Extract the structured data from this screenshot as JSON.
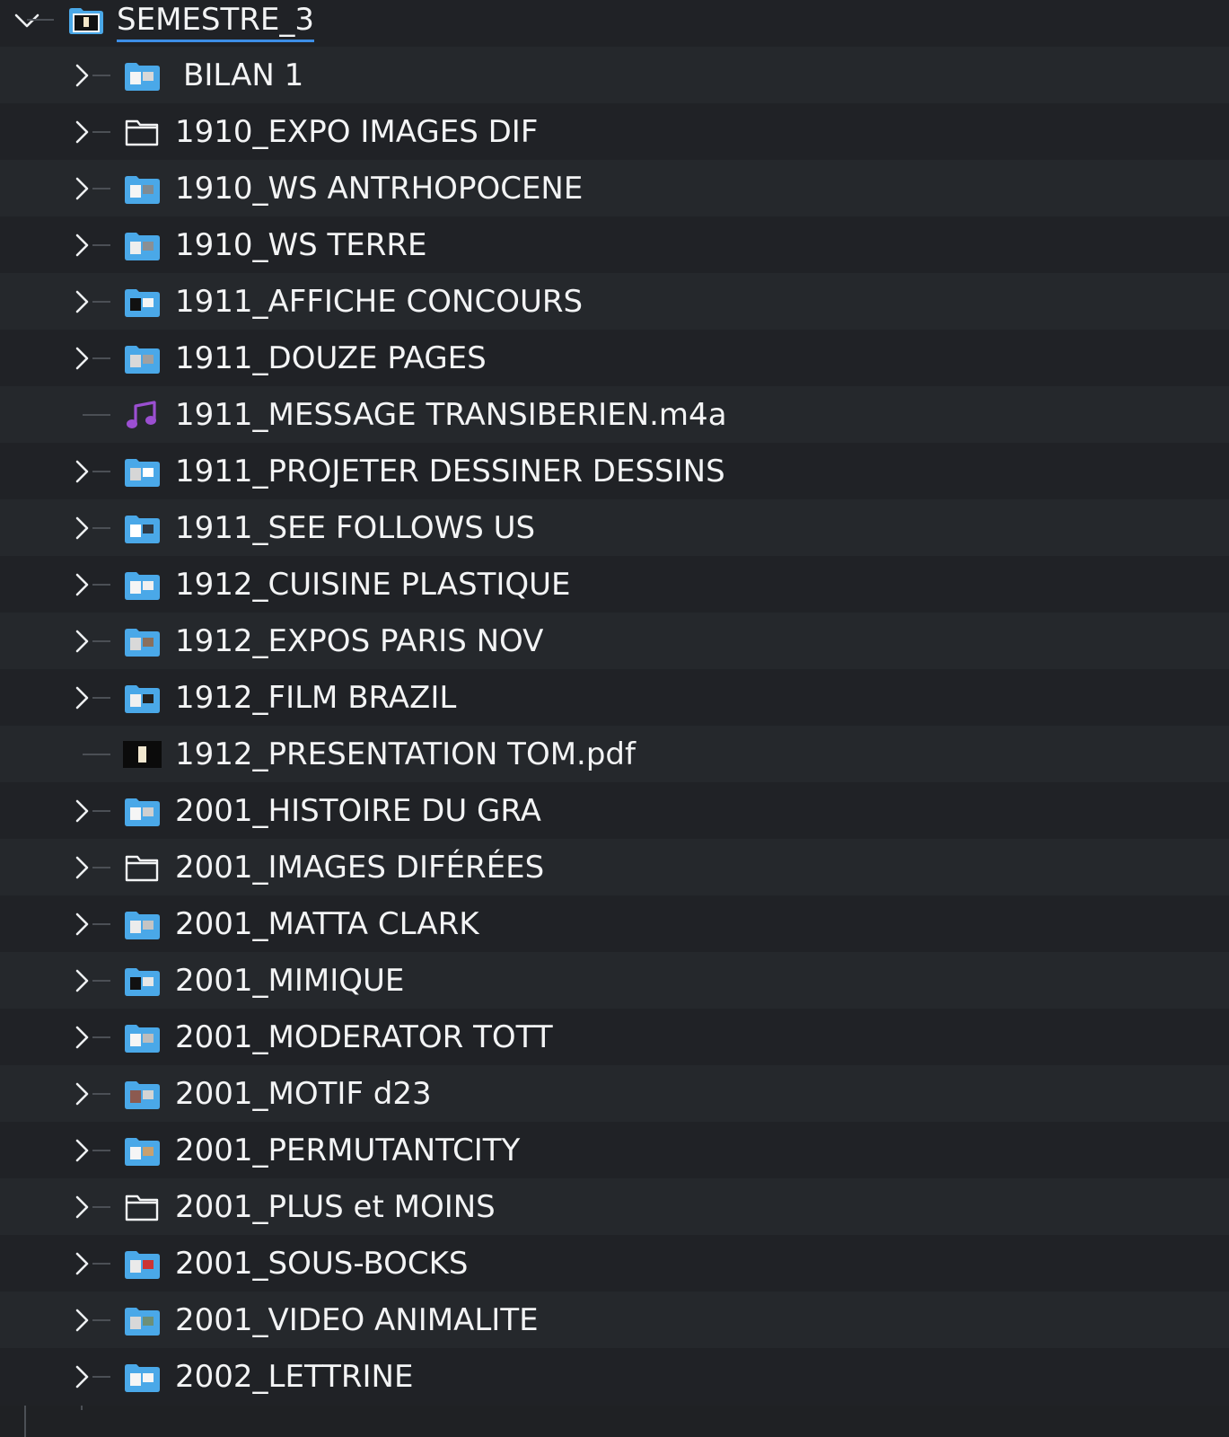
{
  "root": {
    "label": "SEMESTRE_3",
    "expanded": true,
    "icon": "folder-dark-thumb-icon"
  },
  "items": [
    {
      "label": "BILAN 1",
      "kind": "folder-thumb",
      "expandable": true
    },
    {
      "label": "1910_EXPO IMAGES DIF",
      "kind": "folder-outline",
      "expandable": true
    },
    {
      "label": "1910_WS ANTRHOPOCENE",
      "kind": "folder-thumb",
      "expandable": true
    },
    {
      "label": "1910_WS TERRE",
      "kind": "folder-thumb",
      "expandable": true
    },
    {
      "label": "1911_AFFICHE CONCOURS",
      "kind": "folder-thumb",
      "expandable": true
    },
    {
      "label": "1911_DOUZE PAGES",
      "kind": "folder-thumb",
      "expandable": true
    },
    {
      "label": "1911_MESSAGE TRANSIBERIEN.m4a",
      "kind": "audio",
      "expandable": false
    },
    {
      "label": "1911_PROJETER DESSINER DESSINS",
      "kind": "folder-thumb",
      "expandable": true
    },
    {
      "label": "1911_SEE FOLLOWS US",
      "kind": "folder-thumb",
      "expandable": true
    },
    {
      "label": "1912_CUISINE PLASTIQUE",
      "kind": "folder-thumb",
      "expandable": true
    },
    {
      "label": "1912_EXPOS PARIS NOV",
      "kind": "folder-thumb",
      "expandable": true
    },
    {
      "label": "1912_FILM BRAZIL",
      "kind": "folder-thumb",
      "expandable": true
    },
    {
      "label": "1912_PRESENTATION TOM.pdf",
      "kind": "pdf",
      "expandable": false
    },
    {
      "label": "2001_HISTOIRE DU GRA",
      "kind": "folder-thumb",
      "expandable": true
    },
    {
      "label": "2001_IMAGES DIFÉRÉES",
      "kind": "folder-outline",
      "expandable": true
    },
    {
      "label": "2001_MATTA CLARK",
      "kind": "folder-thumb",
      "expandable": true
    },
    {
      "label": "2001_MIMIQUE",
      "kind": "folder-thumb",
      "expandable": true
    },
    {
      "label": "2001_MODERATOR TOTT",
      "kind": "folder-thumb",
      "expandable": true
    },
    {
      "label": "2001_MOTIF d23",
      "kind": "folder-thumb",
      "expandable": true
    },
    {
      "label": "2001_PERMUTANTCITY",
      "kind": "folder-thumb",
      "expandable": true
    },
    {
      "label": "2001_PLUS et MOINS",
      "kind": "folder-outline",
      "expandable": true
    },
    {
      "label": "2001_SOUS-BOCKS",
      "kind": "folder-thumb",
      "expandable": true
    },
    {
      "label": "2001_VIDEO ANIMALITE",
      "kind": "folder-thumb",
      "expandable": true
    },
    {
      "label": "2002_LETTRINE",
      "kind": "folder-thumb",
      "expandable": true
    }
  ],
  "colors": {
    "background": "#1f2124",
    "row_alt": "#25282c",
    "folder_blue": "#4aa8e8",
    "audio_purple": "#9b4fd1",
    "selection_underline": "#3d8ee6",
    "tree_line": "#4b4f55",
    "text": "#f3f4f5"
  },
  "icons": {
    "collapsed": "chevron-right-icon",
    "expanded": "chevron-down-icon"
  }
}
